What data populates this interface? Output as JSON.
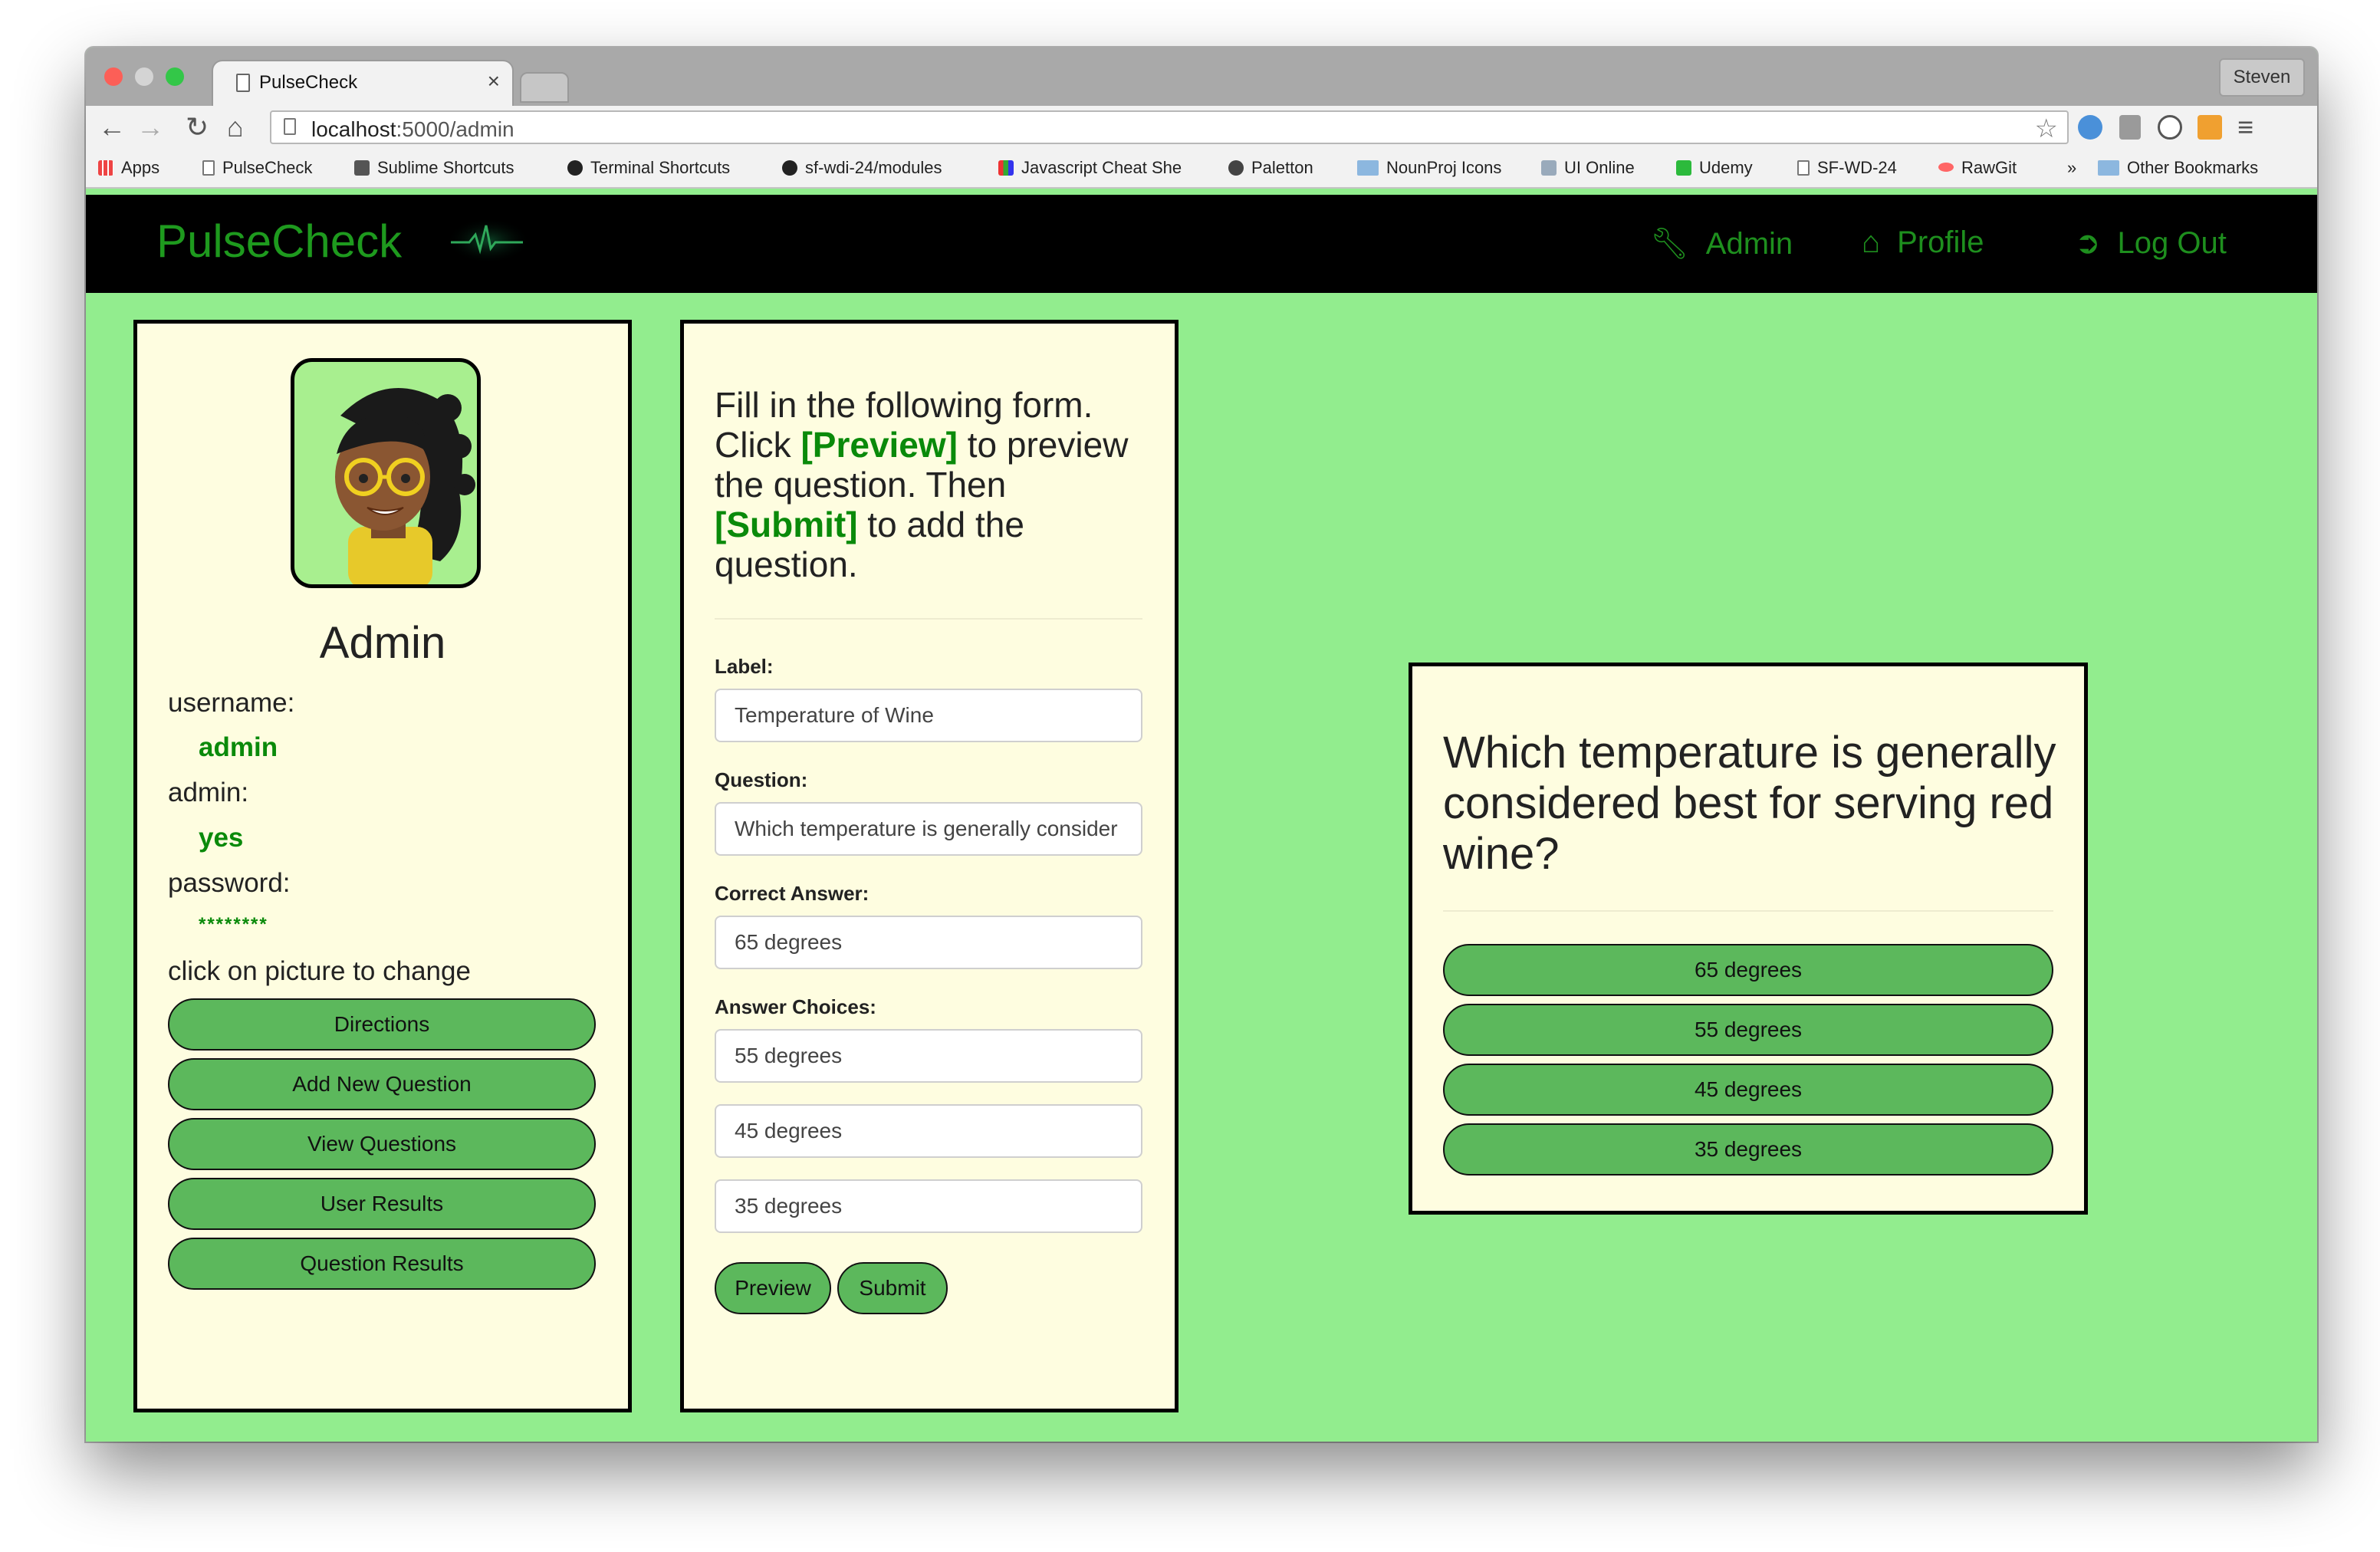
{
  "browser": {
    "tab_title": "PulseCheck",
    "tab_close": "×",
    "profile_name": "Steven",
    "url_host": "localhost",
    "url_path": ":5000/admin",
    "bookmarks": [
      {
        "label": "Apps",
        "icon": "apps-grid-icon"
      },
      {
        "label": "PulseCheck",
        "icon": "page-icon"
      },
      {
        "label": "Sublime Shortcuts",
        "icon": "sublime-icon"
      },
      {
        "label": "Terminal Shortcuts",
        "icon": "github-icon"
      },
      {
        "label": "sf-wdi-24/modules",
        "icon": "github-icon"
      },
      {
        "label": "Javascript Cheat She",
        "icon": "cheatsheet-icon"
      },
      {
        "label": "Paletton",
        "icon": "paletton-icon"
      },
      {
        "label": "NounProj Icons",
        "icon": "folder-icon"
      },
      {
        "label": "UI Online",
        "icon": "ui-online-icon"
      },
      {
        "label": "Udemy",
        "icon": "udemy-icon"
      },
      {
        "label": "SF-WD-24",
        "icon": "page-icon"
      },
      {
        "label": "RawGit",
        "icon": "rawgit-icon"
      }
    ],
    "bookmarks_overflow": "»",
    "other_bookmarks": "Other Bookmarks"
  },
  "app": {
    "brand": "PulseCheck",
    "nav": [
      {
        "label": "Admin",
        "icon": "wrench-icon"
      },
      {
        "label": "Profile",
        "icon": "home-icon"
      },
      {
        "label": "Log Out",
        "icon": "logout-icon"
      }
    ]
  },
  "profile": {
    "name": "Admin",
    "username_label": "username:",
    "username": "admin",
    "admin_label": "admin:",
    "admin_value": "yes",
    "password_label": "password:",
    "password_value": "********",
    "hint": "click on picture to change",
    "buttons": [
      "Directions",
      "Add New Question",
      "View Questions",
      "User Results",
      "Question Results"
    ]
  },
  "form": {
    "instr_1": "Fill in the following form. Click ",
    "instr_preview": "[Preview]",
    "instr_2": " to preview the question. Then ",
    "instr_submit": "[Submit]",
    "instr_3": " to add the question.",
    "label_label": "Label:",
    "label_value": "Temperature of Wine",
    "question_label": "Question:",
    "question_value": "Which temperature is generally consider",
    "correct_label": "Correct Answer:",
    "correct_value": "65 degrees",
    "choices_label": "Answer Choices:",
    "choices": [
      "55 degrees",
      "45 degrees",
      "35 degrees"
    ],
    "preview_button": "Preview",
    "submit_button": "Submit"
  },
  "preview": {
    "question": "Which temperature is generally considered best for serving red wine?",
    "answers": [
      "65 degrees",
      "55 degrees",
      "45 degrees",
      "35 degrees"
    ]
  },
  "colors": {
    "page_bg": "#92ed8e",
    "panel_bg": "#fefde0",
    "accent_green": "#0a8a0a",
    "button_green": "#5cb85c",
    "nav_bg": "#000000"
  }
}
